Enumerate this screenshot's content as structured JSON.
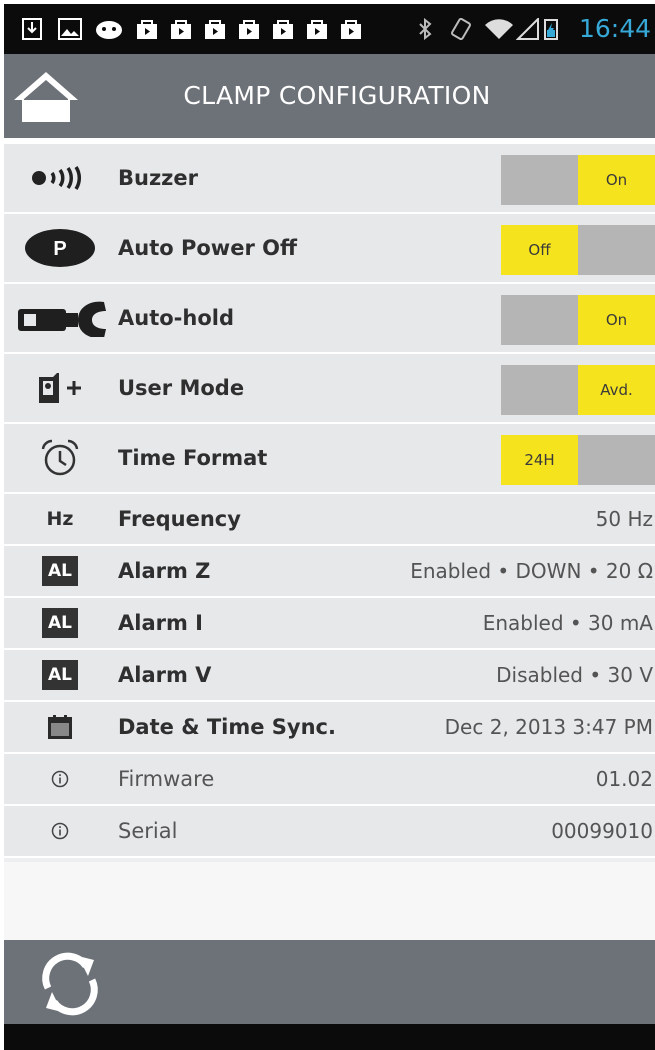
{
  "status_bar": {
    "time": "16:44",
    "left_icons": [
      "download-icon",
      "gallery-icon",
      "android-icon",
      "bag-icon",
      "bag-icon",
      "bag-icon",
      "bag-icon",
      "bag-icon",
      "bag-icon",
      "bag-icon"
    ],
    "right_icons": [
      "bluetooth-icon",
      "rotation-icon",
      "wifi-icon",
      "signal-icon",
      "battery-charging-icon"
    ],
    "time_color": "#36a9d7"
  },
  "header": {
    "title": "CLAMP CONFIGURATION",
    "home_icon": "home-icon",
    "background": "#6d7278"
  },
  "settings": [
    {
      "id": "buzzer",
      "icon": "speaker-icon",
      "label": "Buzzer",
      "type": "toggle",
      "state": "on",
      "off_label": "",
      "on_label": "On"
    },
    {
      "id": "auto-power-off",
      "icon": "power-badge-icon",
      "icon_text": "P",
      "label": "Auto Power Off",
      "type": "toggle",
      "state": "off",
      "off_label": "Off",
      "on_label": ""
    },
    {
      "id": "auto-hold",
      "icon": "clamp-icon",
      "label": "Auto-hold",
      "type": "toggle",
      "state": "on",
      "off_label": "",
      "on_label": "On"
    },
    {
      "id": "user-mode",
      "icon": "user-mode-icon",
      "label": "User Mode",
      "type": "toggle",
      "state": "on",
      "off_label": "",
      "on_label": "Avd."
    },
    {
      "id": "time-format",
      "icon": "alarm-clock-icon",
      "label": "Time Format",
      "type": "toggle",
      "state": "off",
      "off_label": "24H",
      "on_label": ""
    },
    {
      "id": "frequency",
      "icon": "hz-icon",
      "icon_text": "Hz",
      "label": "Frequency",
      "type": "value",
      "value": "50 Hz"
    },
    {
      "id": "alarm-z",
      "icon": "alarm-badge-icon",
      "icon_text": "AL",
      "label": "Alarm Z",
      "type": "value",
      "value": "Enabled • DOWN • 20  Ω"
    },
    {
      "id": "alarm-i",
      "icon": "alarm-badge-icon",
      "icon_text": "AL",
      "label": "Alarm I",
      "type": "value",
      "value": "Enabled • 30  mA"
    },
    {
      "id": "alarm-v",
      "icon": "alarm-badge-icon",
      "icon_text": "AL",
      "label": "Alarm V",
      "type": "value",
      "value": "Disabled • 30  V"
    },
    {
      "id": "date-time-sync",
      "icon": "calendar-icon",
      "label": "Date & Time Sync.",
      "type": "value",
      "value": "Dec 2, 2013 3:47 PM"
    },
    {
      "id": "firmware",
      "icon": "info-icon",
      "label": "Firmware",
      "type": "info",
      "value": "01.02"
    },
    {
      "id": "serial",
      "icon": "info-icon",
      "label": "Serial",
      "type": "info",
      "value": "00099010"
    }
  ],
  "toggle_colors": {
    "active": "#f5e31d",
    "inactive": "#b5b5b5"
  },
  "footer": {
    "refresh_icon": "refresh-icon"
  }
}
